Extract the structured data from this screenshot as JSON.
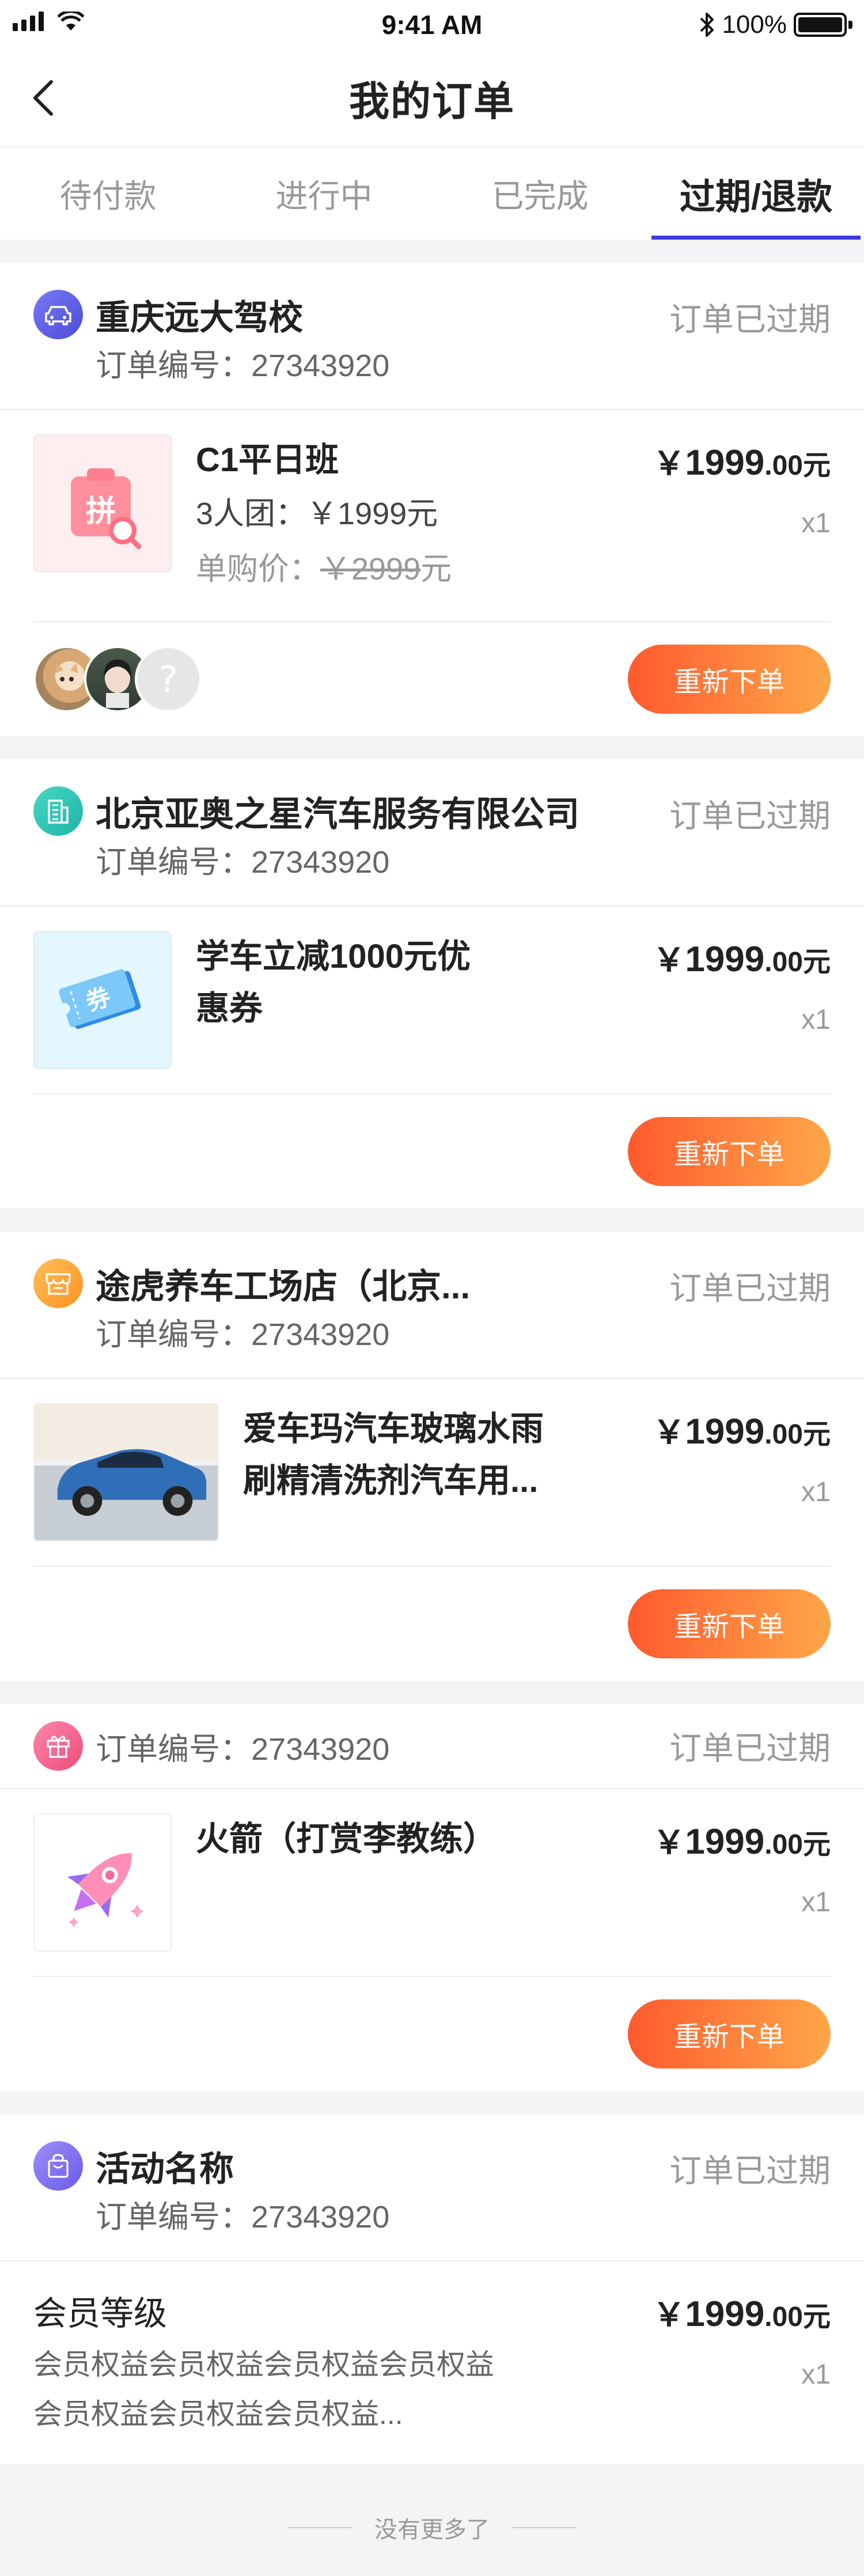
{
  "status_bar": {
    "time": "9:41 AM",
    "battery": "100%"
  },
  "nav": {
    "title": "我的订单"
  },
  "tabs": [
    {
      "label": "待付款"
    },
    {
      "label": "进行中"
    },
    {
      "label": "已完成"
    },
    {
      "label": "过期/退款",
      "active": true
    }
  ],
  "orders": [
    {
      "shop_icon": "car-icon",
      "icon_color": "#5b5be8",
      "shop_name": "重庆远大驾校",
      "order_no": "订单编号：27343920",
      "status": "订单已过期",
      "thumb_icon": "group-buy-icon",
      "title": "C1平日班",
      "group_line": "3人团：￥1999元",
      "single_label": "单购价：",
      "single_price": "￥2999",
      "single_unit": "元",
      "price_cur": "￥",
      "price_int": "1999",
      "price_dec": ".00元",
      "qty": "x1",
      "avatars": [
        "cat-avatar",
        "girl-avatar",
        "unknown-avatar"
      ],
      "unknown_mark": "?",
      "button": "重新下单"
    },
    {
      "shop_icon": "building-icon",
      "icon_color": "#2bc4b4",
      "shop_name": "北京亚奥之星汽车服务有限公司",
      "order_no": "订单编号：27343920",
      "status": "订单已过期",
      "thumb_icon": "coupon-icon",
      "thumb_text": "券",
      "title_lines": [
        "学车立减1000元优",
        "惠券"
      ],
      "price_cur": "￥",
      "price_int": "1999",
      "price_dec": ".00元",
      "qty": "x1",
      "button": "重新下单"
    },
    {
      "shop_icon": "store-icon",
      "icon_color": "#ffa238",
      "shop_name": "途虎养车工场店（北京...",
      "order_no": "订单编号：27343920",
      "status": "订单已过期",
      "thumb_icon": "car-photo",
      "title_lines": [
        "爱车玛汽车玻璃水雨",
        "刷精清洗剂汽车用..."
      ],
      "price_cur": "￥",
      "price_int": "1999",
      "price_dec": ".00元",
      "qty": "x1",
      "button": "重新下单"
    },
    {
      "shop_icon": "gift-icon",
      "icon_color": "#f25b8a",
      "order_no": "订单编号：27343920",
      "status": "订单已过期",
      "thumb_icon": "rocket-icon",
      "title": "火箭（打赏李教练）",
      "price_cur": "￥",
      "price_int": "1999",
      "price_dec": ".00元",
      "qty": "x1",
      "button": "重新下单"
    },
    {
      "shop_icon": "bag-icon",
      "icon_color": "#7a6cf0",
      "shop_name": "活动名称",
      "order_no": "订单编号：27343920",
      "status": "订单已过期",
      "title": "会员等级",
      "desc_lines": [
        "会员权益会员权益会员权益会员权益",
        "会员权益会员权益会员权益..."
      ],
      "price_cur": "￥",
      "price_int": "1999",
      "price_dec": ".00元",
      "qty": "x1"
    }
  ],
  "footer": {
    "text": "没有更多了"
  }
}
